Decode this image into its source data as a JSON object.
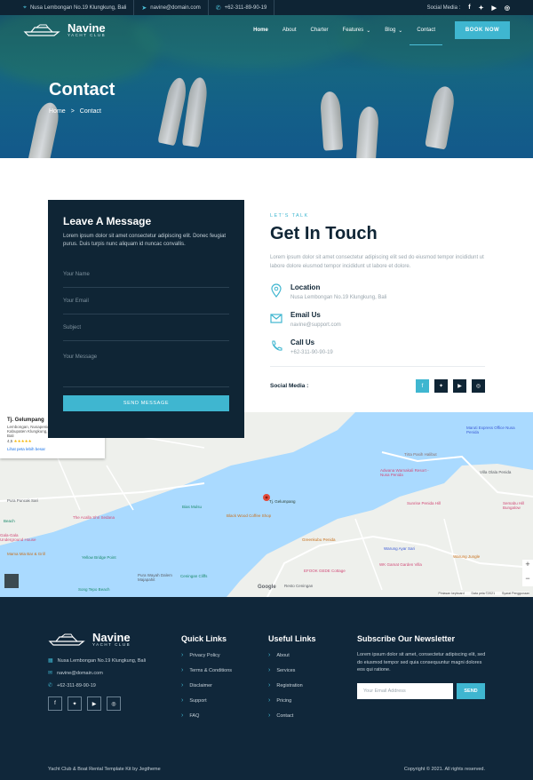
{
  "topbar": {
    "address": "Nusa Lembongan No.19 Klungkung, Bali",
    "email": "navine@domain.com",
    "phone": "+62-311-89-90-19",
    "social_label": "Social Media :"
  },
  "brand": {
    "name": "Navine",
    "tagline": "YACHT CLUB"
  },
  "nav": {
    "items": [
      "Home",
      "About",
      "Charter",
      "Features",
      "Blog",
      "Contact"
    ],
    "book_label": "BOOK NOW"
  },
  "hero": {
    "title": "Contact",
    "crumb_home": "Home",
    "crumb_sep": ">",
    "crumb_current": "Contact"
  },
  "form": {
    "title": "Leave A Message",
    "desc": "Lorem ipsum dolor sit amet consectetur adipiscing elit. Donec feugiat purus. Duis turpis nunc aliquam id nuncac convallis.",
    "name_placeholder": "Your Name",
    "email_placeholder": "Your Email",
    "subject_placeholder": "Subject",
    "message_placeholder": "Your Message",
    "send_label": "SEND MESSAGE"
  },
  "touch": {
    "kicker": "LET'S TALK",
    "title": "Get In Touch",
    "lead": "Lorem ipsum dolor sit amet consectetur adipiscing elit sed do eiusmod tempor incididunt ut labore dolore eiusmod tempor incididunt ut labore et dolore.",
    "location_title": "Location",
    "location_value": "Nusa Lembongan No.19 Klungkung, Bali",
    "email_title": "Email Us",
    "email_value": "navine@support.com",
    "call_title": "Call Us",
    "call_value": "+62-311-90-90-19",
    "social_label": "Social Media :"
  },
  "map": {
    "place_name": "Tj. Gelumpang",
    "place_address": "Lembongan, Nusapenida, Kabupaten Klungkung, Bali",
    "rating": "4,5",
    "stars": "★★★★★",
    "larger_map": "Lihat peta lebih besar",
    "pin_label": "Tj. Gelumpang",
    "labels": [
      "Maruti Express Office Nusa Penida",
      "Tirta Pasih Halibut",
      "Villa Olala Penida",
      "Adwana Warnakali Resort - Nusa Penida",
      "Sunrise Penida Hill",
      "Semabu Hill Bungalow",
      "Pura Puncak Sari",
      "The Acalla Shri Sedana",
      "Bias Mulsu",
      "Black Wood Coffee Shop",
      "Gala-Gala Underground House",
      "Mama Mia Bar & Grill",
      "Yellow Bridge Point",
      "Pura Wayah Dalem Majapahit",
      "Song Tepo Beach",
      "Ceningan Cliffs",
      "Greenkubu Penida",
      "Warung Ayar Sari",
      "Warung Jungle",
      "WK Gamat Garden Villa",
      "EFOOK GEDE Cottage",
      "Resto Ceningan",
      "Beach"
    ],
    "google": "Google",
    "footer_items": [
      "Pintasan keyboard",
      "Data peta ©2021",
      "Syarat Penggunaan"
    ]
  },
  "footer": {
    "address": "Nusa Lembongan No.19 Klungkung, Bali",
    "email": "navine@domain.com",
    "phone": "+62-311-89-90-19",
    "quick_title": "Quick Links",
    "quick_links": [
      "Privacy Policy",
      "Terms & Conditions",
      "Disclaimer",
      "Support",
      "FAQ"
    ],
    "useful_title": "Useful Links",
    "useful_links": [
      "About",
      "Services",
      "Registration",
      "Pricing",
      "Contact"
    ],
    "newsletter_title": "Subscribe Our Newsletter",
    "newsletter_desc": "Lorem ipsum dolor sit amet, consectetur adipiscing elit, sed do eiusmod tempor sed quia consequuntur magni dolores eos qui ratione.",
    "newsletter_placeholder": "Your Email Address",
    "newsletter_btn": "SEND",
    "credit": "Yacht Club & Boat Rental Template Kit by Jegtheme",
    "copyright": "Copyright © 2021. All rights reserved."
  },
  "colors": {
    "accent": "#3fb6d0",
    "navy": "#0f2535",
    "footer": "#10273a",
    "map_water": "#aadaff"
  }
}
